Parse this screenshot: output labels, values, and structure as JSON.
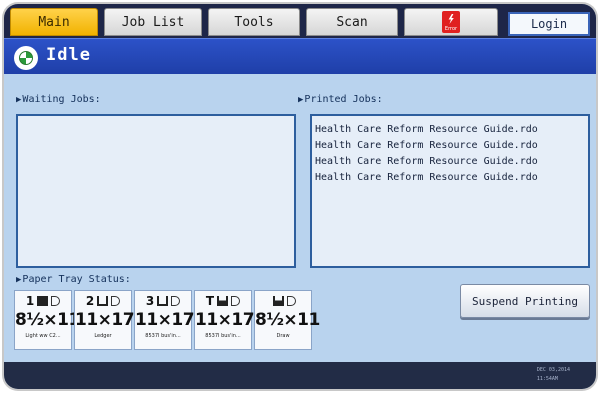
{
  "tabs": [
    {
      "label": "Main"
    },
    {
      "label": "Job List"
    },
    {
      "label": "Tools"
    },
    {
      "label": "Scan"
    }
  ],
  "error_tab": {
    "icon": "error-flash-icon",
    "label": "Error"
  },
  "login": {
    "label": "Login"
  },
  "status": {
    "icon": "machine-status-icon",
    "text": "Idle"
  },
  "waiting_jobs": {
    "label": "Waiting Jobs:",
    "items": []
  },
  "printed_jobs": {
    "label": "Printed Jobs:",
    "items": [
      "Health Care Reform Resource Guide.rdo",
      "Health Care Reform Resource Guide.rdo",
      "Health Care Reform Resource Guide.rdo",
      "Health Care Reform Resource Guide.rdo"
    ]
  },
  "paper_tray": {
    "label": "Paper Tray Status:",
    "trays": [
      {
        "number": "1",
        "size": "8½×11",
        "type": "Light ww C2..."
      },
      {
        "number": "2",
        "size": "11×17",
        "type": "Ledger"
      },
      {
        "number": "3",
        "size": "11×17",
        "type": "8537I bus'in..."
      },
      {
        "number": "T",
        "size": "11×17",
        "type": "8537I bus'in..."
      },
      {
        "number": "",
        "size": "8½×11",
        "type": "Draw"
      }
    ]
  },
  "suspend_button": {
    "label": "Suspend Printing"
  },
  "footer": {
    "date": "DEC 03,2014",
    "time": "11:54AM"
  },
  "colors": {
    "active_tab": "#f1b200",
    "status_bar": "#2448b8",
    "background": "#b9d3ee",
    "list_border": "#2d5e9e"
  }
}
